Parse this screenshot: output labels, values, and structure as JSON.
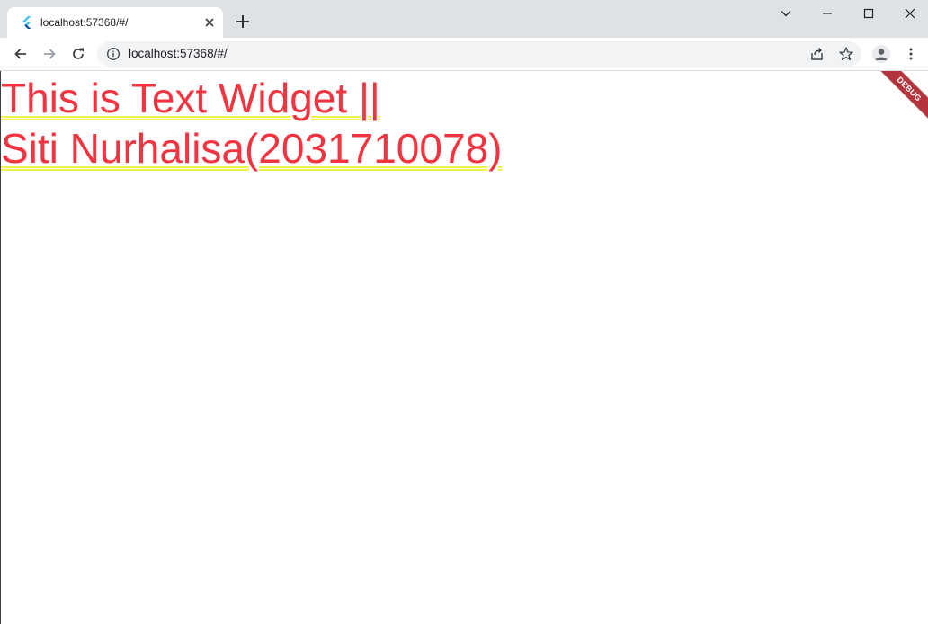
{
  "browser": {
    "tab": {
      "title": "localhost:57368/#/",
      "favicon": "flutter-icon"
    },
    "new_tab_icon": "plus-icon",
    "window_controls": [
      "chevron-down-icon",
      "minimize-icon",
      "maximize-icon",
      "close-icon"
    ],
    "address_bar": {
      "url": "localhost:57368/#/",
      "info_icon": "info-icon"
    },
    "toolbar_icons": [
      "back-arrow-icon",
      "forward-arrow-icon",
      "reload-icon",
      "share-icon",
      "star-icon",
      "profile-icon",
      "more-vert-icon"
    ]
  },
  "page": {
    "lines": [
      "This is Text Widget ||",
      "Siti Nurhalisa(2031710078)"
    ],
    "debug_banner": "DEBUG"
  },
  "colors": {
    "text": "#f23440",
    "underline": "#f2f04a",
    "banner": "#b3343b",
    "tabstrip": "#dee1e6",
    "omnibox": "#f1f3f4"
  }
}
